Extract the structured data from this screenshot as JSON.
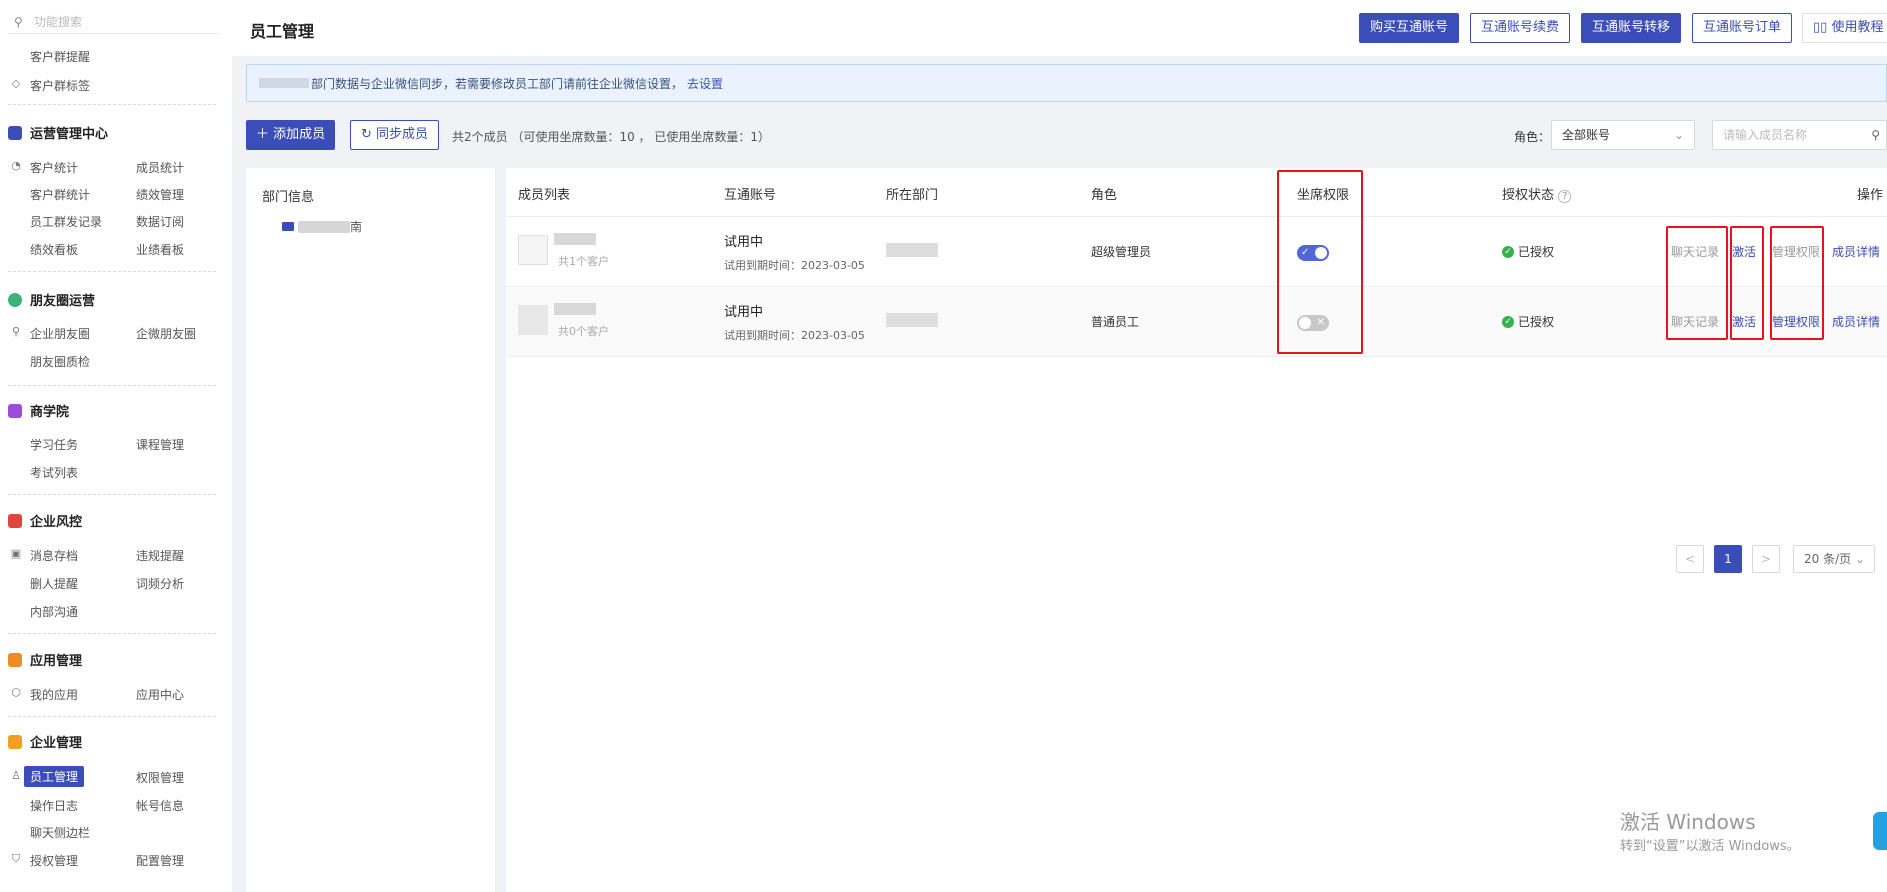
{
  "sidebar": {
    "search_placeholder": "功能搜索",
    "top_items": [
      "客户群提醒",
      "客户群标签"
    ],
    "sections": [
      {
        "title": "运营管理中心",
        "color": "#3b4db8",
        "items": [
          "客户统计",
          "成员统计",
          "客户群统计",
          "绩效管理",
          "员工群发记录",
          "数据订阅",
          "绩效看板",
          "业绩看板"
        ]
      },
      {
        "title": "朋友圈运营",
        "color": "#3ab27a",
        "items": [
          "企业朋友圈",
          "企微朋友圈",
          "朋友圈质检"
        ]
      },
      {
        "title": "商学院",
        "color": "#9a4dd8",
        "items": [
          "学习任务",
          "课程管理",
          "考试列表"
        ]
      },
      {
        "title": "企业风控",
        "color": "#e0443a",
        "items": [
          "消息存档",
          "违规提醒",
          "删人提醒",
          "词频分析",
          "内部沟通"
        ]
      },
      {
        "title": "应用管理",
        "color": "#f08a24",
        "items": [
          "我的应用",
          "应用中心"
        ]
      },
      {
        "title": "企业管理",
        "color": "#f0a020",
        "items": [
          "员工管理",
          "权限管理",
          "操作日志",
          "帐号信息",
          "聊天侧边栏",
          "授权管理",
          "配置管理"
        ]
      }
    ]
  },
  "header": {
    "title": "员工管理",
    "buttons": [
      "购买互通账号",
      "互通账号续费",
      "互通账号转移",
      "互通账号订单",
      "使用教程"
    ]
  },
  "notice": {
    "text": "部门数据与企业微信同步，若需要修改员工部门请前往企业微信设置，",
    "link": "去设置"
  },
  "toolbar": {
    "add_label": "添加成员",
    "sync_label": "同步成员",
    "count_text": "共2个成员  （可使用坐席数量：10 ，  已使用坐席数量：1）",
    "role_label": "角色：",
    "role_value": "全部账号",
    "search_placeholder": "请输入成员名称"
  },
  "dept": {
    "title": "部门信息",
    "node_suffix": "南"
  },
  "table": {
    "headers": [
      "成员列表",
      "互通账号",
      "所在部门",
      "角色",
      "坐席权限",
      "授权状态",
      "操作"
    ],
    "rows": [
      {
        "customers": "共1个客户",
        "status": "试用中",
        "expire": "试用到期时间：2023-03-05",
        "role": "超级管理员",
        "seat_enabled": true,
        "auth": "已授权",
        "ops": [
          "聊天记录",
          "激活",
          "管理权限",
          "成员详情"
        ]
      },
      {
        "customers": "共0个客户",
        "status": "试用中",
        "expire": "试用到期时间：2023-03-05",
        "role": "普通员工",
        "seat_enabled": false,
        "auth": "已授权",
        "ops": [
          "聊天记录",
          "激活",
          "管理权限",
          "成员详情"
        ]
      }
    ]
  },
  "pagination": {
    "current": "1",
    "prev": "<",
    "next": ">",
    "page_size": "20 条/页"
  },
  "watermark": {
    "line1": "激活 Windows",
    "line2": "转到“设置”以激活 Windows。"
  }
}
